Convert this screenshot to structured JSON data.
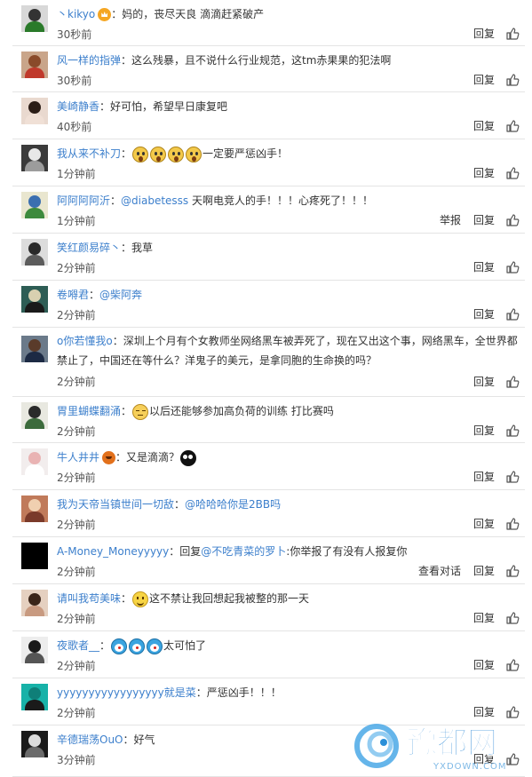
{
  "labels": {
    "reply": "回复",
    "report": "举报",
    "view_conversation": "查看对话"
  },
  "comments": [
    {
      "user": "丶kikyo",
      "parts": [
        {
          "t": "text",
          "v": "：妈的，丧尽天良 滴滴赶紧破产"
        }
      ],
      "time": "30秒前",
      "badge": "crown",
      "av": [
        "#d8d8d8",
        "#333",
        "#2a7a2a"
      ]
    },
    {
      "user": "风一样的指弹",
      "parts": [
        {
          "t": "text",
          "v": "：这么残暴，且不说什么行业规范，这tm赤果果的犯法啊"
        }
      ],
      "time": "30秒前",
      "av": [
        "#c9a58a",
        "#8a4a2a",
        "#c0392b"
      ]
    },
    {
      "user": "美崎静香",
      "parts": [
        {
          "t": "text",
          "v": "：好可怕，希望早日康复吧"
        }
      ],
      "time": "40秒前",
      "av": [
        "#e9d9cf",
        "#2b1d16",
        "#f0e0d6"
      ]
    },
    {
      "user": "我从来不补刀",
      "parts": [
        {
          "t": "text",
          "v": "："
        },
        {
          "t": "emoji",
          "v": "scream"
        },
        {
          "t": "emoji",
          "v": "scream"
        },
        {
          "t": "emoji",
          "v": "scream"
        },
        {
          "t": "emoji",
          "v": "scream"
        },
        {
          "t": "text",
          "v": "一定要严惩凶手！"
        }
      ],
      "time": "1分钟前",
      "av": [
        "#3b3b3b",
        "#e8e8e8",
        "#9c9c9c"
      ]
    },
    {
      "user": "阿阿阿阿沂",
      "parts": [
        {
          "t": "text",
          "v": "："
        },
        {
          "t": "mention",
          "v": "@diabetesss"
        },
        {
          "t": "text",
          "v": " 天啊电竞人的手！！！心疼死了！！！"
        }
      ],
      "time": "1分钟前",
      "report": true,
      "av": [
        "#e9e6cf",
        "#3b6fb0",
        "#3d8a3d"
      ]
    },
    {
      "user": "笑红颜易碎丶",
      "parts": [
        {
          "t": "text",
          "v": "：我草"
        }
      ],
      "time": "2分钟前",
      "av": [
        "#dcdcdc",
        "#2a2a2a",
        "#5c5c5c"
      ]
    },
    {
      "user": "卷嘚君",
      "parts": [
        {
          "t": "text",
          "v": "："
        },
        {
          "t": "mention",
          "v": "@柴阿奔"
        }
      ],
      "time": "2分钟前",
      "av": [
        "#2e5d55",
        "#d8d0b0",
        "#1a1a1a"
      ]
    },
    {
      "user": "o你若懂我o",
      "parts": [
        {
          "t": "text",
          "v": "：深圳上个月有个女教师坐网络黑车被弄死了，现在又出这个事，网络黑车，全世界都禁止了，中国还在等什么？洋鬼子的美元，是拿同胞的生命换的吗？"
        }
      ],
      "time": "2分钟前",
      "wrap": true,
      "av": [
        "#6b7a8a",
        "#5a3b2a",
        "#1c2a44"
      ]
    },
    {
      "user": "胃里蝴蝶翻涌",
      "parts": [
        {
          "t": "text",
          "v": "："
        },
        {
          "t": "emoji",
          "v": "sweat"
        },
        {
          "t": "text",
          "v": "以后还能够参加高负荷的训练 打比赛吗"
        }
      ],
      "time": "2分钟前",
      "av": [
        "#e8e8e0",
        "#2a2a2a",
        "#3c6b3c"
      ]
    },
    {
      "user": "牛人井井",
      "parts": [
        {
          "t": "text",
          "v": "：又是滴滴？"
        },
        {
          "t": "emoji",
          "v": "skull"
        }
      ],
      "time": "2分钟前",
      "badge": "pumpkin",
      "av": [
        "#f2eded",
        "#e9b3b3",
        "#ffffff"
      ]
    },
    {
      "user": "我为天帝当镇世间一切敌",
      "parts": [
        {
          "t": "text",
          "v": "："
        },
        {
          "t": "mention",
          "v": "@哈哈哈你是2BB吗"
        }
      ],
      "time": "2分钟前",
      "av": [
        "#c07a5a",
        "#f0d0b0",
        "#7a3a2a"
      ]
    },
    {
      "user": "A-Money_Moneyyyyy",
      "parts": [
        {
          "t": "text",
          "v": "：回复"
        },
        {
          "t": "mention",
          "v": "@不吃青菜的罗卜"
        },
        {
          "t": "text",
          "v": ":你举报了有没有人报复你"
        }
      ],
      "time": "2分钟前",
      "view_conv": true,
      "av": [
        "#000000",
        "#000000",
        "#000000"
      ]
    },
    {
      "user": "请叫我苟美味",
      "parts": [
        {
          "t": "text",
          "v": "："
        },
        {
          "t": "emoji",
          "v": "smile"
        },
        {
          "t": "text",
          "v": "这不禁让我回想起我被整的那一天"
        }
      ],
      "time": "2分钟前",
      "av": [
        "#e5d0c0",
        "#3a2418",
        "#c89a80"
      ]
    },
    {
      "user": "夜歌者__",
      "parts": [
        {
          "t": "text",
          "v": "："
        },
        {
          "t": "emoji",
          "v": "doraemon"
        },
        {
          "t": "emoji",
          "v": "doraemon"
        },
        {
          "t": "emoji",
          "v": "doraemon"
        },
        {
          "t": "text",
          "v": "太可怕了"
        }
      ],
      "time": "2分钟前",
      "av": [
        "#ededed",
        "#1a1a1a",
        "#555555"
      ]
    },
    {
      "user": "yyyyyyyyyyyyyyyyy就是菜",
      "parts": [
        {
          "t": "text",
          "v": "：严惩凶手！！！"
        }
      ],
      "time": "2分钟前",
      "av": [
        "#17b2a8",
        "#0f7f78",
        "#1a1a1a"
      ]
    },
    {
      "user": "辛德瑞荡OuO",
      "parts": [
        {
          "t": "text",
          "v": "：好气"
        }
      ],
      "time": "3分钟前",
      "av": [
        "#1a1a1a",
        "#dcdcdc",
        "#6b6b6b"
      ]
    }
  ],
  "watermark": {
    "brand": "豫都网",
    "domain": "YXDOWN.COM"
  }
}
